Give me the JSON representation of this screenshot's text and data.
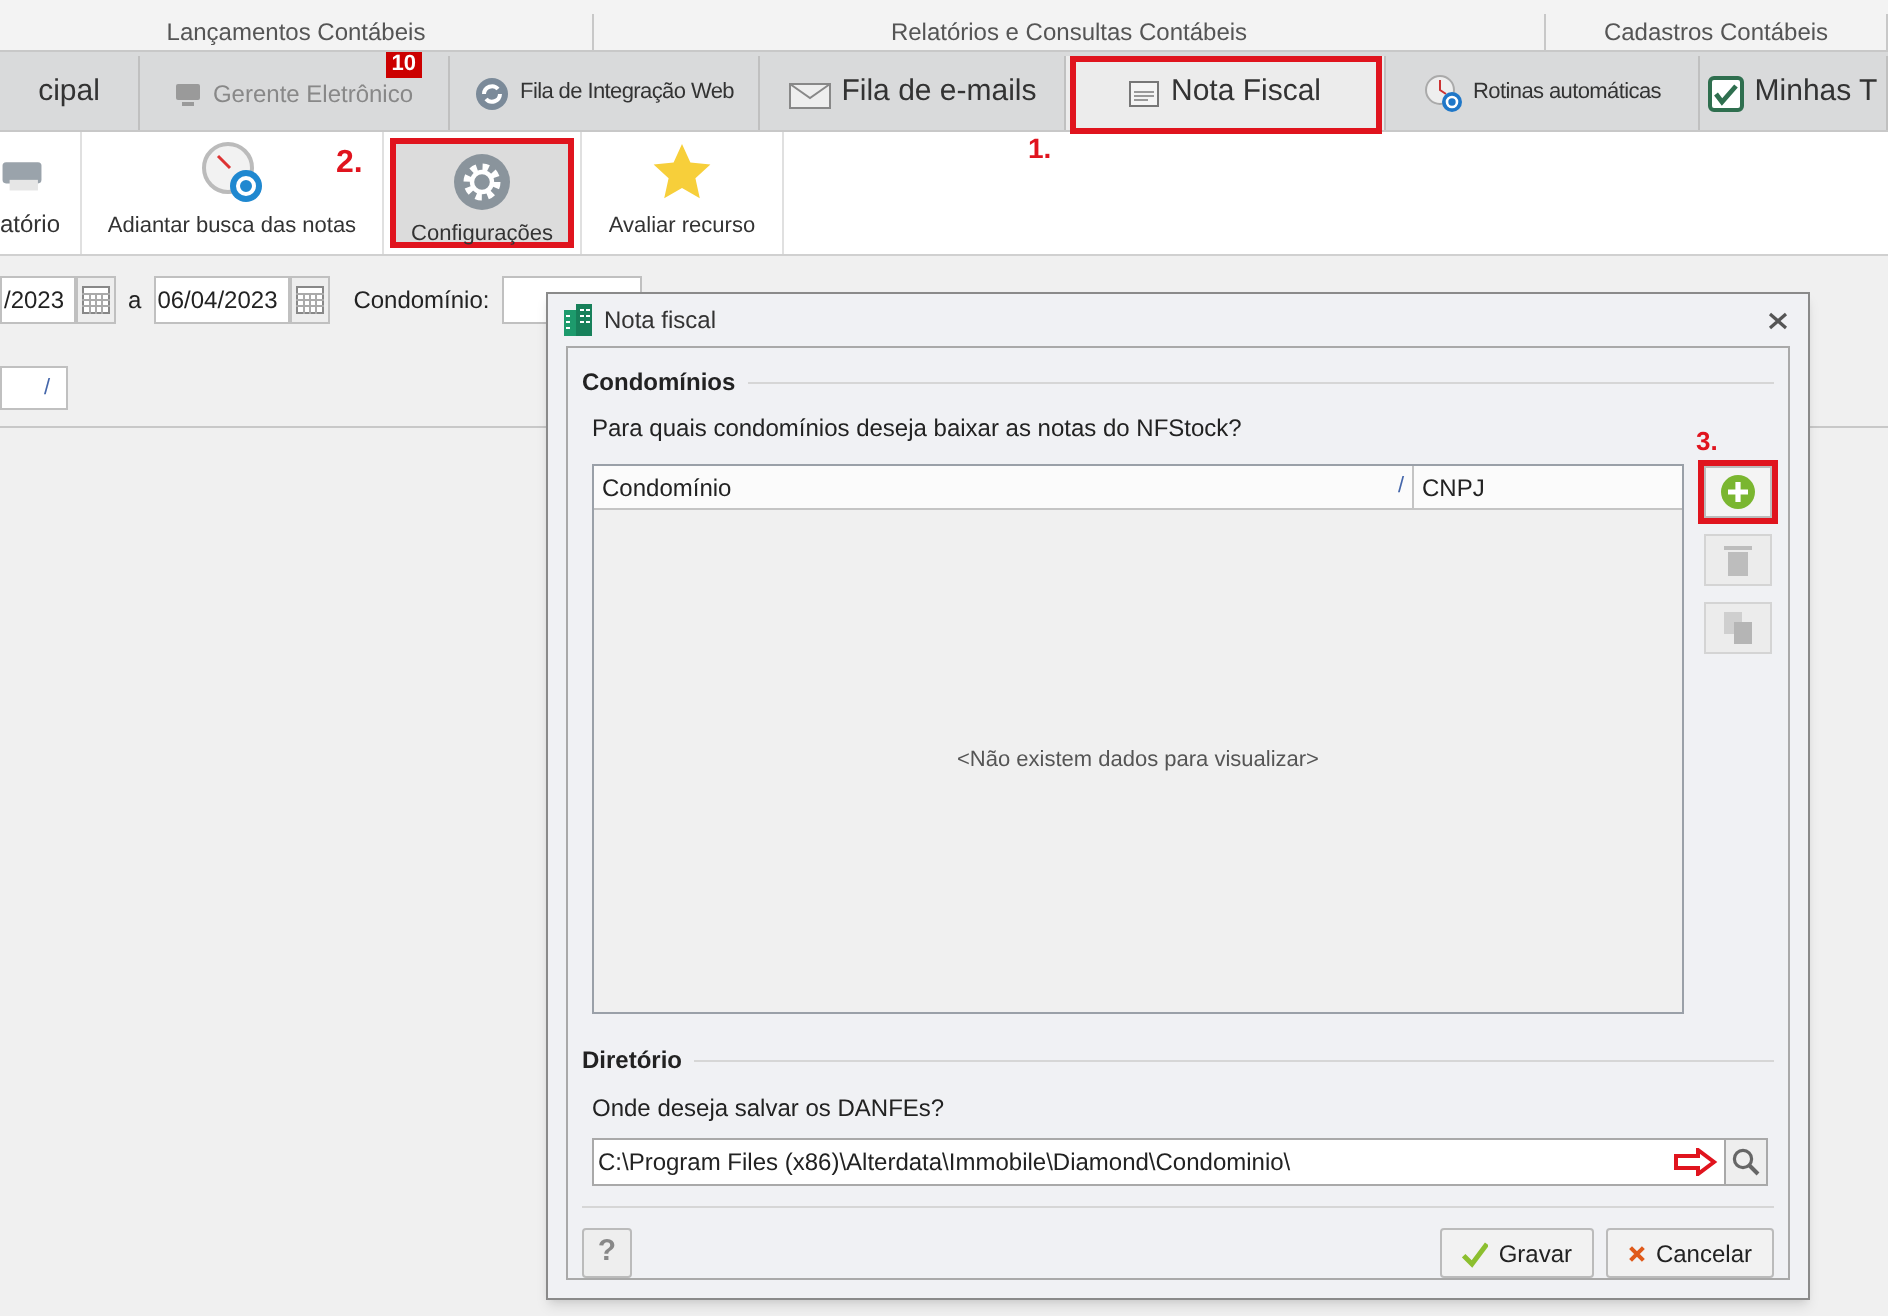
{
  "ribbon_groups": [
    "Lançamentos Contábeis",
    "Relatórios e Consultas Contábeis",
    "Cadastros Contábeis"
  ],
  "tabs": [
    {
      "label": "cipal",
      "kind": "plain",
      "selected": false
    },
    {
      "label": "Gerente Eletrônico",
      "kind": "monitor",
      "selected": false,
      "badge": "10"
    },
    {
      "label": "Fila de Integração Web",
      "kind": "sync",
      "selected": false
    },
    {
      "label": "Fila de e-mails",
      "kind": "mail",
      "selected": false
    },
    {
      "label": "Nota Fiscal",
      "kind": "document",
      "selected": true,
      "annotation": "1."
    },
    {
      "label": "Rotinas automáticas",
      "kind": "clock",
      "selected": false
    },
    {
      "label": "Minhas T",
      "kind": "check",
      "selected": false
    }
  ],
  "toolbar": [
    {
      "label": "atório",
      "kind": "printer"
    },
    {
      "label": "Adiantar busca das notas",
      "kind": "clock"
    },
    {
      "label": "Configurações",
      "kind": "gear",
      "annotation": "2."
    },
    {
      "label": "Avaliar recurso",
      "kind": "star"
    }
  ],
  "filters": {
    "date_from": "/2023",
    "separator": "a",
    "date_to": "06/04/2023",
    "condominio_label": "Condomínio:"
  },
  "column_filter": "/",
  "dialog": {
    "title": "Nota fiscal",
    "condominios": {
      "heading": "Condomínios",
      "question": "Para quais condomínios deseja baixar as notas do NFStock?",
      "columns": [
        "Condomínio",
        "CNPJ"
      ],
      "sort_mark": "/",
      "empty_message": "<Não existem dados para visualizar>",
      "side_buttons": [
        {
          "kind": "add",
          "disabled": false,
          "annotation": "3."
        },
        {
          "kind": "delete",
          "disabled": true
        },
        {
          "kind": "copy",
          "disabled": true
        }
      ]
    },
    "directory": {
      "heading": "Diretório",
      "question": "Onde deseja salvar os DANFEs?",
      "value": "C:\\Program Files (x86)\\Alterdata\\Immobile\\Diamond\\Condominio\\"
    },
    "help": "?",
    "buttons": [
      {
        "label": "Gravar",
        "kind": "save"
      },
      {
        "label": "Cancelar",
        "kind": "cancel"
      }
    ]
  }
}
